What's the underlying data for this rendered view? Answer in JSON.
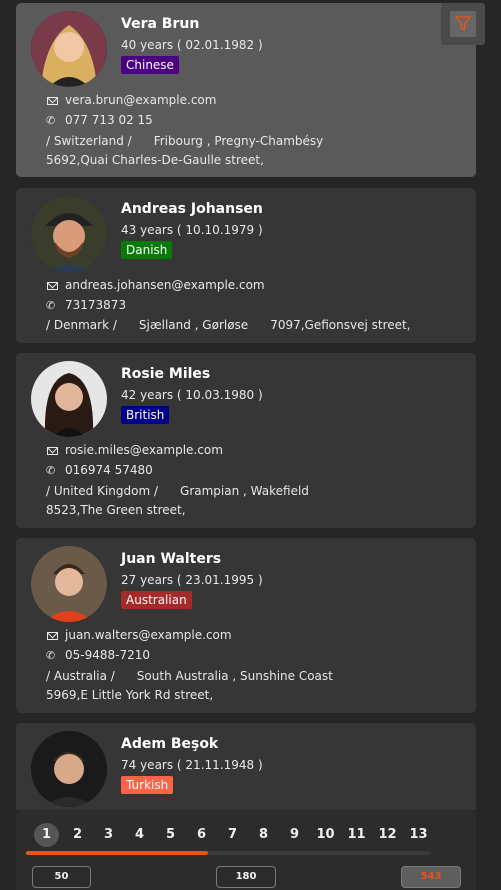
{
  "accent_color": "#e2561b",
  "filter": {
    "icon": "filter-icon"
  },
  "contacts": [
    {
      "name": "Vera Brun",
      "age": "40 years ( 02.01.1982 )",
      "nationality": "Chinese",
      "badge_color": "#4b0082",
      "email": "vera.brun@example.com",
      "phone": "077 713 02 15",
      "country": "/ Switzerland /",
      "region": "Fribourg , Pregny-Chambésy",
      "street": "5692,Quai Charles-De-Gaulle street,",
      "selected": true
    },
    {
      "name": "Andreas Johansen",
      "age": "43 years ( 10.10.1979 )",
      "nationality": "Danish",
      "badge_color": "#087a08",
      "email": "andreas.johansen@example.com",
      "phone": "73173873",
      "country": "/ Denmark /",
      "region": "Sjælland , Gørløse",
      "street": "7097,Gefionsvej street,"
    },
    {
      "name": "Rosie Miles",
      "age": "42 years ( 10.03.1980 )",
      "nationality": "British",
      "badge_color": "#00008b",
      "email": "rosie.miles@example.com",
      "phone": "016974 57480",
      "country": "/ United Kingdom /",
      "region": "Grampian , Wakefield",
      "street": "8523,The Green street,"
    },
    {
      "name": "Juan Walters",
      "age": "27 years ( 23.01.1995 )",
      "nationality": "Australian",
      "badge_color": "#a52a2a",
      "email": "juan.walters@example.com",
      "phone": "05-9488-7210",
      "country": "/ Australia /",
      "region": "South Australia , Sunshine Coast",
      "street": "5969,E Little York Rd street,"
    },
    {
      "name": "Adem Beşok",
      "age": "74 years ( 21.11.1948 )",
      "nationality": "Turkish",
      "badge_color": "#ff6347"
    }
  ],
  "pagination": {
    "pages": [
      "1",
      "2",
      "3",
      "4",
      "5",
      "6",
      "7",
      "8",
      "9",
      "10",
      "11",
      "12",
      "13"
    ],
    "current_page": "1",
    "scroll_progress": 0.45
  },
  "page_sizes": [
    {
      "label": "50"
    },
    {
      "label": "180"
    },
    {
      "label": "543",
      "active": true
    }
  ]
}
